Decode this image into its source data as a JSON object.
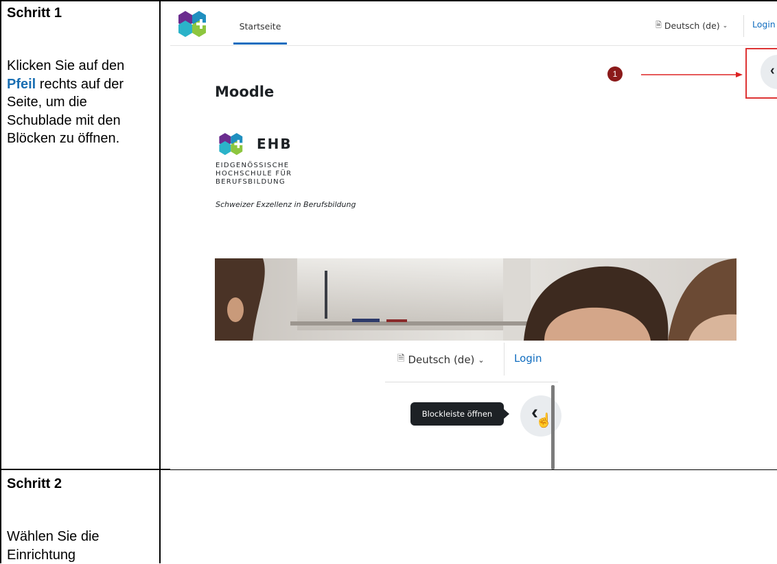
{
  "step1": {
    "title": "Schritt 1",
    "text_before": "Klicken Sie auf den ",
    "highlight": "Pfeil",
    "text_after": " rechts auf der Seite, um die Schublade mit den Blöcken zu öffnen."
  },
  "step2": {
    "title": "Schritt 2",
    "text": "Wählen Sie die Einrichtung"
  },
  "screenshot": {
    "nav_tab": "Startseite",
    "language": "Deutsch (de)",
    "login": "Login",
    "page_title": "Moodle",
    "logo": {
      "name": "EHB",
      "line1": "EIDGENÖSSISCHE",
      "line2": "HOCHSCHULE FÜR",
      "line3": "BERUFSBILDUNG",
      "tagline": "Schweizer Exzellenz in Berufsbildung"
    },
    "callout_number": "1",
    "zoom": {
      "language": "Deutsch (de)",
      "login": "Login",
      "tooltip": "Blockleiste öffnen"
    }
  },
  "colors": {
    "highlight_blue": "#1a6fb3",
    "callout_red": "#b01e1e",
    "moodle_blue": "#0f6cbf"
  }
}
